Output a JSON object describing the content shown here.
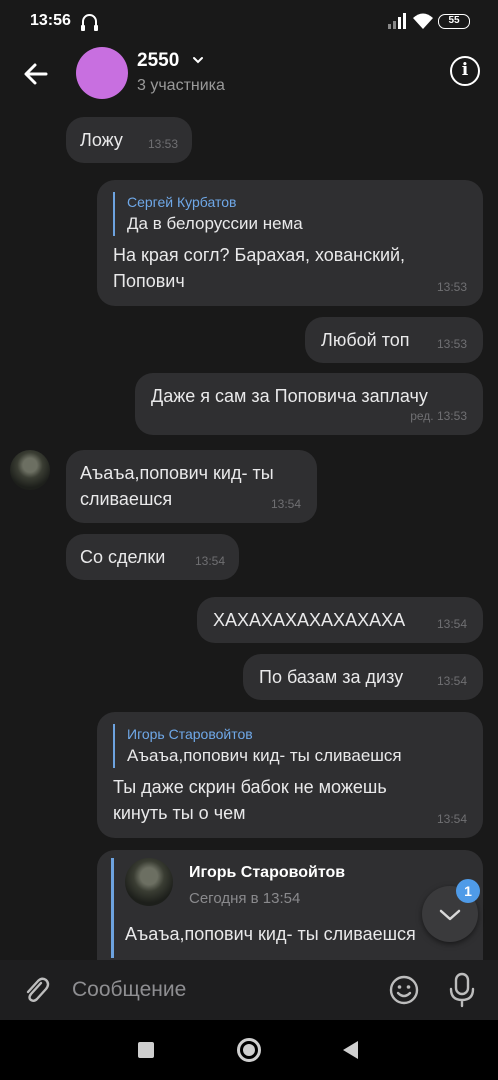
{
  "status_bar": {
    "time": "13:56",
    "battery": "55",
    "icons": [
      "headset-icon",
      "signal-icon",
      "wifi-icon",
      "battery-icon"
    ]
  },
  "header": {
    "title": "2550",
    "subtitle": "3 участника",
    "icons": [
      "back-arrow-icon",
      "chevron-down-icon",
      "info-icon"
    ]
  },
  "messages": [
    {
      "side": "in",
      "text": "Ложу",
      "time": "13:53"
    },
    {
      "side": "out",
      "reply_author": "Сергей Курбатов",
      "reply_text": "Да в белоруссии нема",
      "text_lines": [
        "На края согл? Барахая, хованский,",
        "Попович"
      ],
      "time": "13:53"
    },
    {
      "side": "out",
      "text": "Любой топ",
      "time": "13:53"
    },
    {
      "side": "out",
      "text": "Даже я сам за Поповича заплачу",
      "time": "ред. 13:53"
    },
    {
      "side": "in",
      "text_lines": [
        "Аъаъа,попович кид- ты",
        "сливаешся"
      ],
      "time": "13:54"
    },
    {
      "side": "in",
      "text": "Со сделки",
      "time": "13:54"
    },
    {
      "side": "out",
      "text": "ХАХАХАХАХАХАХАХА",
      "time": "13:54"
    },
    {
      "side": "out",
      "text": "По базам за дизу",
      "time": "13:54"
    },
    {
      "side": "out",
      "reply_author": "Игорь Старовойтов",
      "reply_text": "Аъаъа,попович кид- ты сливаешся",
      "text_lines": [
        "Ты даже скрин бабок не можешь",
        "кинуть ты о чем"
      ],
      "time": "13:54"
    }
  ],
  "forwarded": {
    "name": "Игорь Старовойтов",
    "date": "Сегодня в 13:54",
    "text": "Аъаъа,попович кид- ты сливаешся"
  },
  "scroll_badge": "1",
  "input": {
    "placeholder": "Сообщение",
    "icons": [
      "paperclip-icon",
      "emoji-icon",
      "microphone-icon"
    ]
  },
  "colors": {
    "background": "#191919",
    "bubble": "#2f2f31",
    "accent": "#6da3e0",
    "avatar": "#c86fe0",
    "badge": "#4f9be8"
  }
}
